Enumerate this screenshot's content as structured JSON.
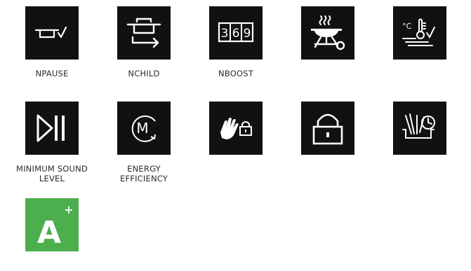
{
  "icons": [
    {
      "name": "pot-check-icon",
      "label": "NPAUSE"
    },
    {
      "name": "pot-arrow-icon",
      "label": "NCHILD"
    },
    {
      "name": "boost-369-icon",
      "label": "NBOOST",
      "digits": [
        "3",
        "6",
        "9"
      ]
    },
    {
      "name": "grill-key-icon",
      "label": ""
    },
    {
      "name": "temperature-check-icon",
      "label": "",
      "unit": "°C"
    },
    {
      "name": "play-pause-icon",
      "label": "MINIMUM SOUND\nLEVEL"
    },
    {
      "name": "energy-m-icon",
      "label": "ENERGY\nEFFICIENCY",
      "letter": "M"
    },
    {
      "name": "hand-lock-icon",
      "label": ""
    },
    {
      "name": "lock-icon",
      "label": ""
    },
    {
      "name": "pasta-timer-icon",
      "label": ""
    }
  ],
  "energy_class": {
    "letter": "A",
    "sup": "+",
    "color": "#4cae4c"
  }
}
